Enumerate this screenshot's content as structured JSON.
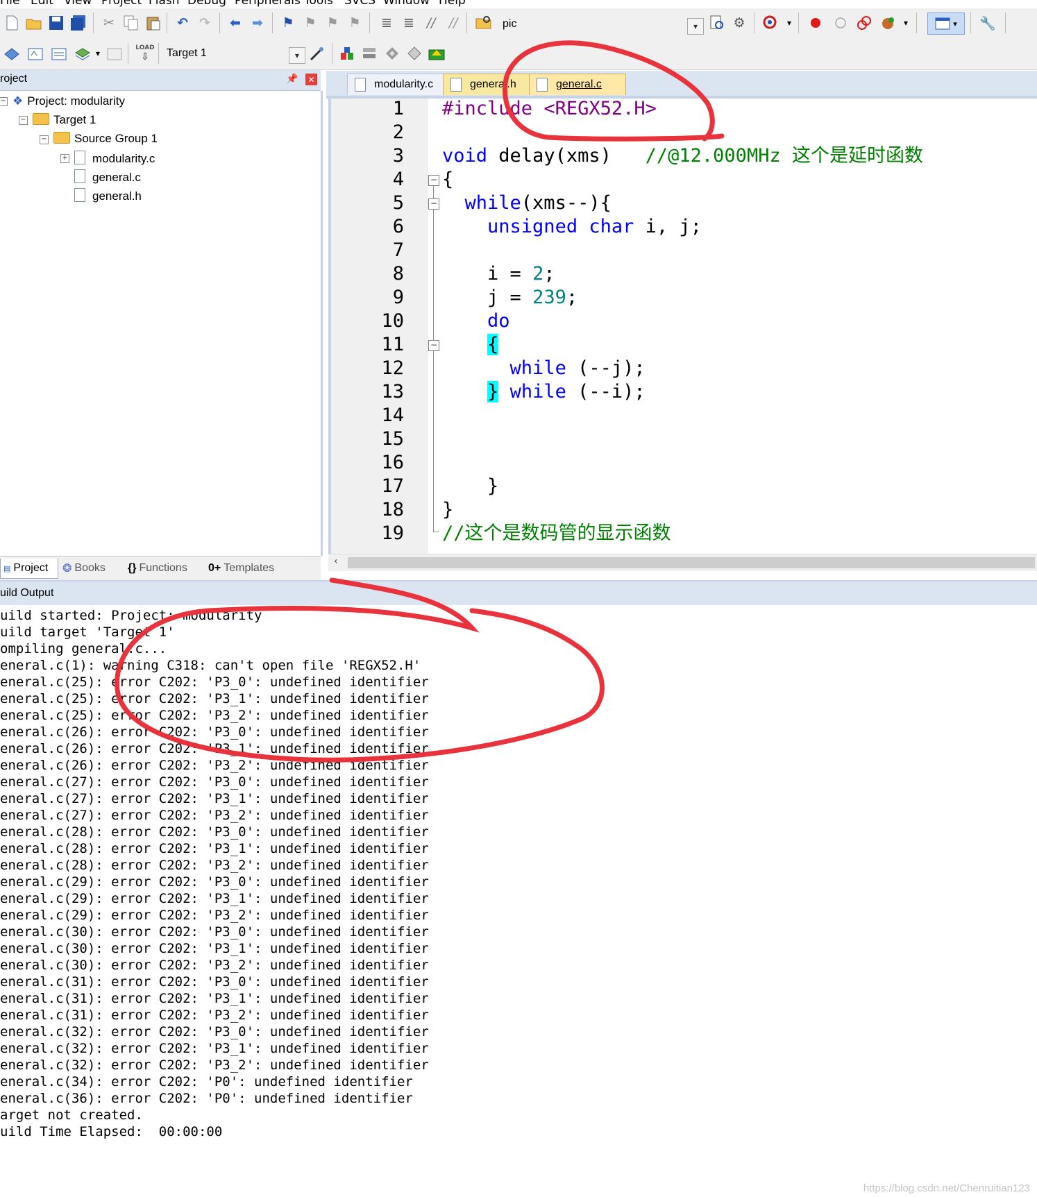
{
  "menu": {
    "items": [
      "File",
      "Edit",
      "View",
      "Project",
      "Flash",
      "Debug",
      "Peripherals",
      "Tools",
      "SVCS",
      "Window",
      "Help"
    ]
  },
  "toolbar": {
    "find_combo_value": "pic",
    "target_combo_value": "Target 1",
    "load_label": "LOAD"
  },
  "project_panel": {
    "title": "roject",
    "tree": {
      "project": "Project: modularity",
      "target": "Target 1",
      "group": "Source Group 1",
      "files": [
        "modularity.c",
        "general.c",
        "general.h"
      ]
    },
    "bottom_tabs": [
      "Project",
      "Books",
      "Functions",
      "Templates"
    ],
    "bottom_tab_glyphs": [
      "{}",
      "0+"
    ]
  },
  "editor": {
    "tabs": [
      "modularity.c",
      "general.h",
      "general.c"
    ],
    "active_tab": "general.c",
    "line_numbers": [
      "1",
      "2",
      "3",
      "4",
      "5",
      "6",
      "7",
      "8",
      "9",
      "10",
      "11",
      "12",
      "13",
      "14",
      "15",
      "16",
      "17",
      "18",
      "19"
    ],
    "code": {
      "l1_pp": "#include",
      "l1_hdr": "<REGX52.H>",
      "l3_kw": "void",
      "l3_rest": "delay(xms)",
      "l3_cm": "//@12.000MHz 这个是延时函数",
      "l4": "{",
      "l5_kw": "while",
      "l5_rest": "(xms--){",
      "l6_kw": "unsigned char",
      "l6_rest": "i, j;",
      "l8_a": "i = ",
      "l8_num": "2",
      "l8_b": ";",
      "l9_a": "j = ",
      "l9_num": "239",
      "l9_b": ";",
      "l10_kw": "do",
      "l11": "{",
      "l12_kw": "while",
      "l12_rest": "(--j);",
      "l13_brace": "}",
      "l13_kw": "while",
      "l13_rest": "(--i);",
      "l17": "}",
      "l18": "}",
      "l19_cm": "//这个是数码管的显示函数"
    }
  },
  "build_output": {
    "title": "uild Output",
    "lines": [
      "uild started: Project: modularity",
      "uild target 'Target 1'",
      "ompiling general.c...",
      "eneral.c(1): warning C318: can't open file 'REGX52.H'",
      "eneral.c(25): error C202: 'P3_0': undefined identifier",
      "eneral.c(25): error C202: 'P3_1': undefined identifier",
      "eneral.c(25): error C202: 'P3_2': undefined identifier",
      "eneral.c(26): error C202: 'P3_0': undefined identifier",
      "eneral.c(26): error C202: 'P3_1': undefined identifier",
      "eneral.c(26): error C202: 'P3_2': undefined identifier",
      "eneral.c(27): error C202: 'P3_0': undefined identifier",
      "eneral.c(27): error C202: 'P3_1': undefined identifier",
      "eneral.c(27): error C202: 'P3_2': undefined identifier",
      "eneral.c(28): error C202: 'P3_0': undefined identifier",
      "eneral.c(28): error C202: 'P3_1': undefined identifier",
      "eneral.c(28): error C202: 'P3_2': undefined identifier",
      "eneral.c(29): error C202: 'P3_0': undefined identifier",
      "eneral.c(29): error C202: 'P3_1': undefined identifier",
      "eneral.c(29): error C202: 'P3_2': undefined identifier",
      "eneral.c(30): error C202: 'P3_0': undefined identifier",
      "eneral.c(30): error C202: 'P3_1': undefined identifier",
      "eneral.c(30): error C202: 'P3_2': undefined identifier",
      "eneral.c(31): error C202: 'P3_0': undefined identifier",
      "eneral.c(31): error C202: 'P3_1': undefined identifier",
      "eneral.c(31): error C202: 'P3_2': undefined identifier",
      "eneral.c(32): error C202: 'P3_0': undefined identifier",
      "eneral.c(32): error C202: 'P3_1': undefined identifier",
      "eneral.c(32): error C202: 'P3_2': undefined identifier",
      "eneral.c(34): error C202: 'P0': undefined identifier",
      "eneral.c(36): error C202: 'P0': undefined identifier",
      "arget not created.",
      "uild Time Elapsed:  00:00:00"
    ]
  },
  "watermark": "https://blog.csdn.net/Chenruitian123",
  "colors": {
    "keyword": "#0000ff",
    "number": "#008080",
    "preprocessor": "#800080",
    "comment": "#008000",
    "brace_highlight": "#00ffff",
    "annotation_red": "#e8323c",
    "panel_header": "#dbe4f1"
  },
  "icons": [
    "new-file-icon",
    "open-folder-icon",
    "save-icon",
    "save-all-icon",
    "cut-icon",
    "copy-icon",
    "paste-icon",
    "undo-icon",
    "redo-icon",
    "nav-back-icon",
    "nav-forward-icon",
    "bookmark-icon",
    "indent-icon",
    "outdent-icon",
    "comment-icon",
    "uncomment-icon",
    "find-in-files-icon",
    "debug-icon",
    "breakpoint-icon",
    "build-icon",
    "rebuild-icon",
    "download-icon",
    "options-icon",
    "settings-icon"
  ]
}
